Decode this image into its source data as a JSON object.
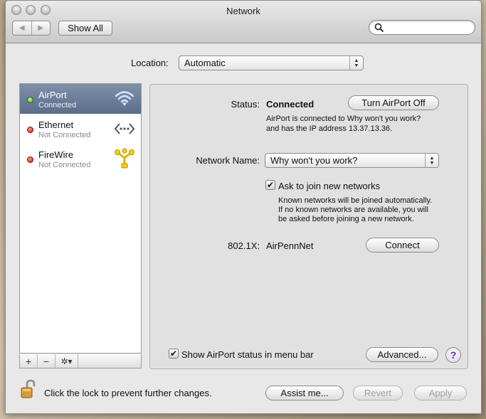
{
  "window": {
    "title": "Network"
  },
  "toolbar": {
    "back_label": "◀",
    "forward_label": "▶",
    "show_all": "Show All",
    "search_placeholder": ""
  },
  "location": {
    "label": "Location:",
    "value": "Automatic"
  },
  "services": [
    {
      "name": "AirPort",
      "status": "Connected",
      "indicator": "green",
      "icon": "wifi-icon",
      "selected": true
    },
    {
      "name": "Ethernet",
      "status": "Not Connected",
      "indicator": "red",
      "icon": "ethernet-icon",
      "selected": false
    },
    {
      "name": "FireWire",
      "status": "Not Connected",
      "indicator": "red",
      "icon": "firewire-icon",
      "selected": false
    }
  ],
  "sidebar_toolbar": {
    "add": "+",
    "remove": "−",
    "action": "✲▾"
  },
  "detail": {
    "status_label": "Status:",
    "status_value": "Connected",
    "turn_off_button": "Turn AirPort Off",
    "status_desc_line1": "AirPort is connected to Why won't you work?",
    "status_desc_line2": "and has the IP address 13.37.13.36.",
    "network_name_label": "Network Name:",
    "network_name_value": "Why won't you work?",
    "ask_join_label": "Ask to join new networks",
    "ask_join_checked": true,
    "ask_desc_line1": "Known networks will be joined automatically.",
    "ask_desc_line2": "If no known networks are available, you will",
    "ask_desc_line3": "be asked before joining a new network.",
    "dot1x_label": "802.1X:",
    "dot1x_value": "AirPennNet",
    "connect_button": "Connect",
    "show_status_label": "Show AirPort status in menu bar",
    "show_status_checked": true,
    "advanced_button": "Advanced...",
    "help_button": "?"
  },
  "footer": {
    "lock_text": "Click the lock to prevent further changes.",
    "assist_button": "Assist me...",
    "revert_button": "Revert",
    "apply_button": "Apply"
  },
  "colors": {
    "selected_row": "#6a7c98",
    "connected": "#3fa51e",
    "disconnected": "#d0160a",
    "help_accent": "#5a2a9a"
  }
}
